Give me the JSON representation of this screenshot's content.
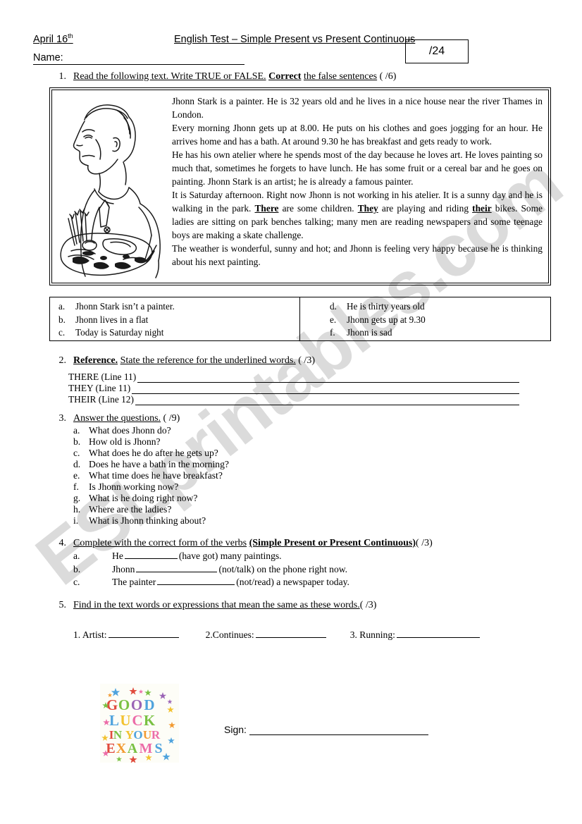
{
  "header": {
    "date": "April 16",
    "date_superscript": "th",
    "test_title": "English Test – Simple Present vs Present Continuous",
    "name_label": "Name:",
    "score_total": "/24"
  },
  "tasks": {
    "t1": {
      "number": "1.",
      "part_a": "Read the following text. Write TRUE or FALSE.",
      "part_bold": "Correct",
      "part_b": "the false sentences",
      "points": "(      /6)"
    },
    "t2": {
      "number": "2.",
      "bold_lead": "Reference.",
      "rest": "State the reference for the underlined words.",
      "points": "(      /3)"
    },
    "t3": {
      "number": "3.",
      "lead": "Answer the questions.",
      "points": "(    /9)"
    },
    "t4": {
      "number": "4.",
      "lead": "Complete with the correct form of the verbs",
      "bold_part": "(Simple Present or Present Continuous)",
      "points": "(  /3)"
    },
    "t5": {
      "number": "5.",
      "lead": "Find in the text words or expressions that mean the same as these words.",
      "points": "(   /3)"
    }
  },
  "reading": {
    "figure_name": "painter-illustration",
    "paragraphs": [
      "Jhonn Stark is a painter. He is 32 years old and he lives in a nice house near the river Thames in London.",
      "Every morning Jhonn gets up at 8.00. He puts on his clothes and goes jogging for an hour. He arrives home and has a bath. At around 9.30 he has breakfast and gets ready to work.",
      "He has his own atelier where he spends most of the day because he loves art. He loves painting so much that, sometimes he forgets to have lunch. He has some fruit or a cereal bar and he goes on painting. Jhonn Stark is an artist; he is already a famous painter."
    ],
    "para4_pre": "It is Saturday afternoon. Right now Jhonn is not working in his atelier. It is a sunny day and he is walking in the park. ",
    "para4_w1": "There",
    "para4_mid1": " are some children. ",
    "para4_w2": "They",
    "para4_mid2": " are playing and riding ",
    "para4_w3": "their",
    "para4_post": " bikes. Some ladies are sitting on park benches talking; many men are reading newspapers and some teenage boys are making a skate challenge.",
    "para5": "The weather is wonderful, sunny and hot; and Jhonn is feeling very happy because he is thinking about his next painting."
  },
  "true_false": {
    "left": [
      {
        "letter": "a.",
        "text": "Jhonn Stark isn’t a painter."
      },
      {
        "letter": "b.",
        "text": "Jhonn lives in a flat"
      },
      {
        "letter": "c.",
        "text": "Today is Saturday night"
      }
    ],
    "right": [
      {
        "letter": "d.",
        "text": "He is thirty years old"
      },
      {
        "letter": "e.",
        "text": "Jhonn gets up at 9.30"
      },
      {
        "letter": "f.",
        "text": "Jhonn is sad"
      }
    ]
  },
  "reference_lines": [
    {
      "label": "THERE (Line 11)"
    },
    {
      "label": "THEY (Line 11)"
    },
    {
      "label": "THEIR (Line 12)"
    }
  ],
  "questions": [
    {
      "letter": "a.",
      "text": "What does Jhonn do?"
    },
    {
      "letter": "b.",
      "text": "How old is Jhonn?"
    },
    {
      "letter": "c.",
      "text": "What does he do after he gets up?"
    },
    {
      "letter": "d.",
      "text": "Does he have a bath in the morning?"
    },
    {
      "letter": "e.",
      "text": "What time does he have breakfast?"
    },
    {
      "letter": "f.",
      "text": "Is Jhonn working now?"
    },
    {
      "letter": "g.",
      "text": "What is he doing right now?"
    },
    {
      "letter": "h.",
      "text": "Where are the ladies?"
    },
    {
      "letter": "i.",
      "text": "What is Jhonn thinking about?"
    }
  ],
  "verb_items": [
    {
      "letter": "a.",
      "before": "He",
      "after": "(have got) many paintings."
    },
    {
      "letter": "b.",
      "before": "Jhonn",
      "after": "(not/talk) on the phone right now."
    },
    {
      "letter": "c.",
      "before": "The painter",
      "after": "(not/read) a newspaper today."
    }
  ],
  "vocab_items": [
    {
      "label": "1. Artist:"
    },
    {
      "label": "2.Continues:"
    },
    {
      "label": "3. Running:"
    }
  ],
  "good_luck": {
    "line1": "GOOD",
    "line2": "LUCK",
    "line3": "IN YOUR",
    "line4": "EXAMS",
    "colors": {
      "red": "#e04a3c",
      "orange": "#f29a31",
      "yellow": "#f2c230",
      "green": "#7ac143",
      "teal": "#3fb8af",
      "blue": "#4fa3dd",
      "purple": "#9a63b5",
      "pink": "#ec6ca8"
    }
  },
  "sign": {
    "label": "Sign:"
  },
  "watermark": {
    "text": "ESLprintables.com"
  }
}
